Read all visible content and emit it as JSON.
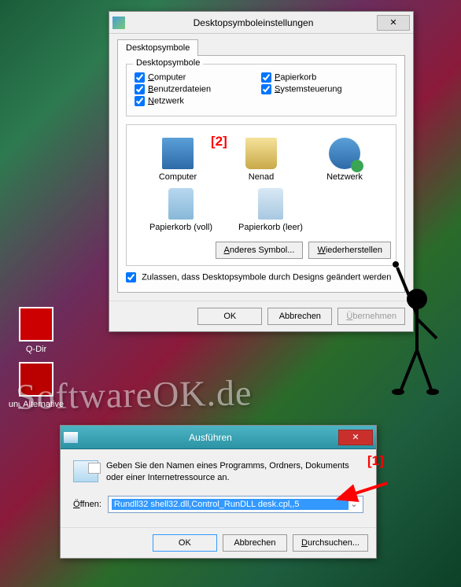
{
  "desktop": {
    "icons": [
      {
        "label": "Q-Dir"
      },
      {
        "label": "un_Alternative"
      }
    ]
  },
  "settings": {
    "title": "Desktopsymboleinstellungen",
    "tab": "Desktopsymbole",
    "group_label": "Desktopsymbole",
    "checkboxes": {
      "computer": {
        "label": "Computer",
        "underline": "C"
      },
      "benutzer": {
        "label": "Benutzerdateien",
        "underline": "B"
      },
      "netzwerk": {
        "label": "Netzwerk",
        "underline": "N"
      },
      "papierkorb": {
        "label": "Papierkorb",
        "underline": "P"
      },
      "system": {
        "label": "Systemsteuerung",
        "underline": "S"
      }
    },
    "icons": {
      "computer": "Computer",
      "nenad": "Nenad",
      "netzwerk": "Netzwerk",
      "bin_full": "Papierkorb (voll)",
      "bin_empty": "Papierkorb (leer)"
    },
    "btn_change": "Anderes Symbol...",
    "btn_restore": "Wiederherstellen",
    "allow_themes": "Zulassen, dass Desktopsymbole durch Designs geändert werden",
    "ok": "OK",
    "cancel": "Abbrechen",
    "apply": "Übernehmen"
  },
  "run": {
    "title": "Ausführen",
    "desc": "Geben Sie den Namen eines Programms, Ordners, Dokuments oder einer Internetressource an.",
    "open_label": "Öffnen:",
    "command": "Rundll32 shell32.dll,Control_RunDLL desk.cpl,,5",
    "ok": "OK",
    "cancel": "Abbrechen",
    "browse": "Durchsuchen..."
  },
  "annotations": {
    "a1": "[1]",
    "a2": "[2]"
  },
  "watermark": "SoftwareOK.de"
}
